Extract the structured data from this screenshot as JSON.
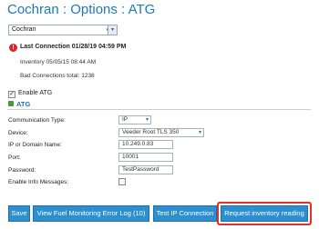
{
  "header": {
    "title": "Cochran : Options : ATG"
  },
  "site_select": {
    "value": "Cochran"
  },
  "status": {
    "last_connection": "Last Connection 01/28/19 04:59 PM",
    "inventory": "Inventory 05/05/15 08:44 AM",
    "bad_connections": "Bad Connections total: 1238"
  },
  "enable_atg": {
    "label": "Enable ATG",
    "checked": true
  },
  "atg_link": {
    "label": "ATG"
  },
  "form": {
    "communication_type": {
      "label": "Communication Type:",
      "value": "IP"
    },
    "device": {
      "label": "Device:",
      "value": "Veeder Root TLS 350"
    },
    "ip": {
      "label": "IP or Domain Name:",
      "value": "10.249.0.83"
    },
    "port": {
      "label": "Port:",
      "value": "10001"
    },
    "password": {
      "label": "Password:",
      "value": "TestPassword"
    },
    "enable_info": {
      "label": "Enable Info Messages:"
    }
  },
  "buttons": {
    "save": "Save",
    "view_log": "View Fuel Monitoring Error Log (10)",
    "test_ip": "Test IP Connection",
    "request_inventory": "Request inventory reading"
  },
  "colors": {
    "title": "#1e7ab8",
    "button": "#2d8ed0",
    "highlight": "#e0302a",
    "alert": "#d02a2a"
  }
}
